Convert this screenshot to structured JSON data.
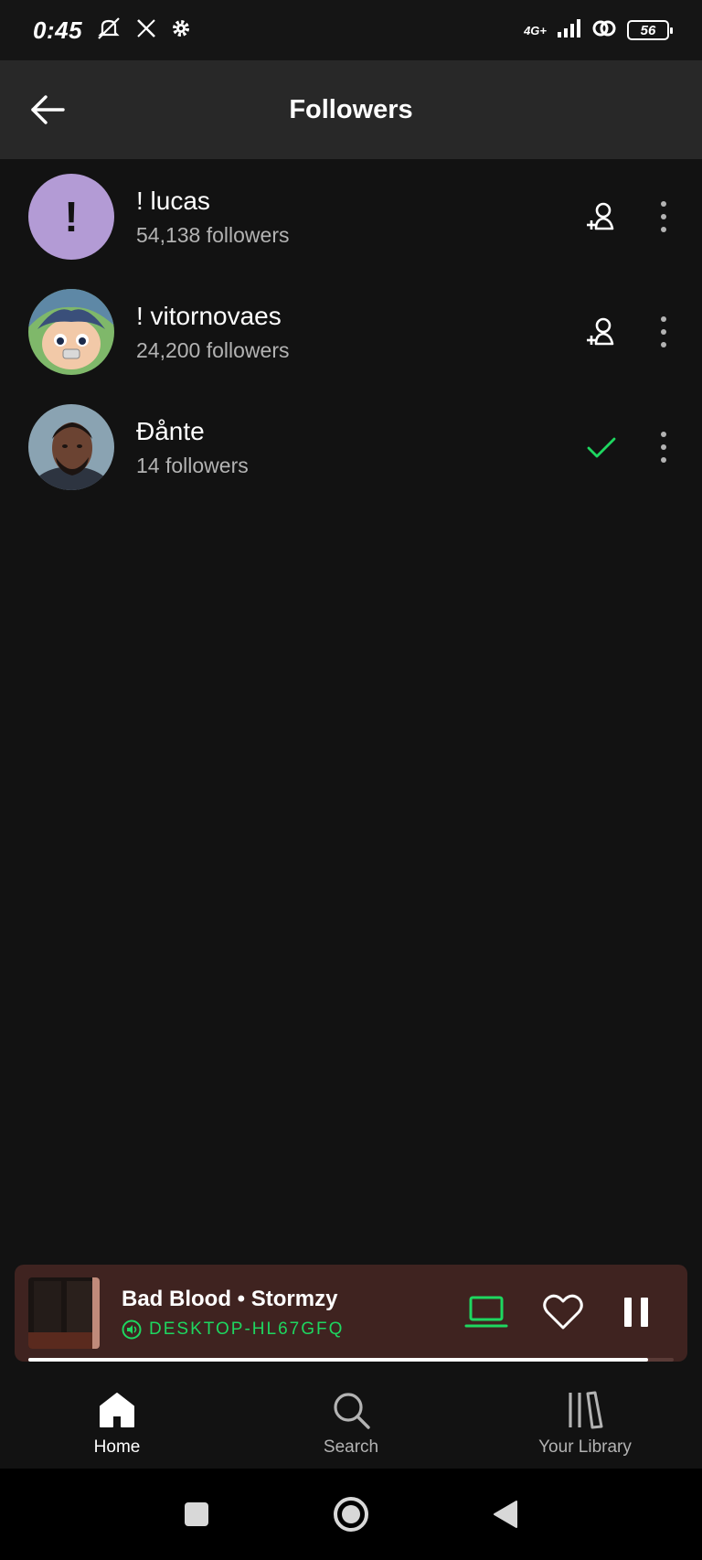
{
  "status_bar": {
    "time": "0:45",
    "network": "4G+",
    "battery": "56"
  },
  "header": {
    "title": "Followers",
    "back_icon": "arrow-left-icon"
  },
  "followers": [
    {
      "name": "! lucas",
      "followers": "54,138 followers",
      "avatar_letter": "!",
      "action": "follow"
    },
    {
      "name": "! vitornovaes",
      "followers": "24,200 followers",
      "avatar_letter": "",
      "action": "follow"
    },
    {
      "name": "Đånte",
      "followers": "14 followers",
      "avatar_letter": "",
      "action": "following"
    }
  ],
  "player": {
    "track": "Bad Blood • Stormzy",
    "device": "DESKTOP-HL67GFQ",
    "progress": 0.96,
    "accent": "#1ed760"
  },
  "nav": {
    "home": "Home",
    "search": "Search",
    "library": "Your Library"
  },
  "colors": {
    "background": "#121212",
    "header": "#282828",
    "player_bg": "#3f2320",
    "accent": "#1ed760",
    "muted": "#b3b3b3"
  }
}
